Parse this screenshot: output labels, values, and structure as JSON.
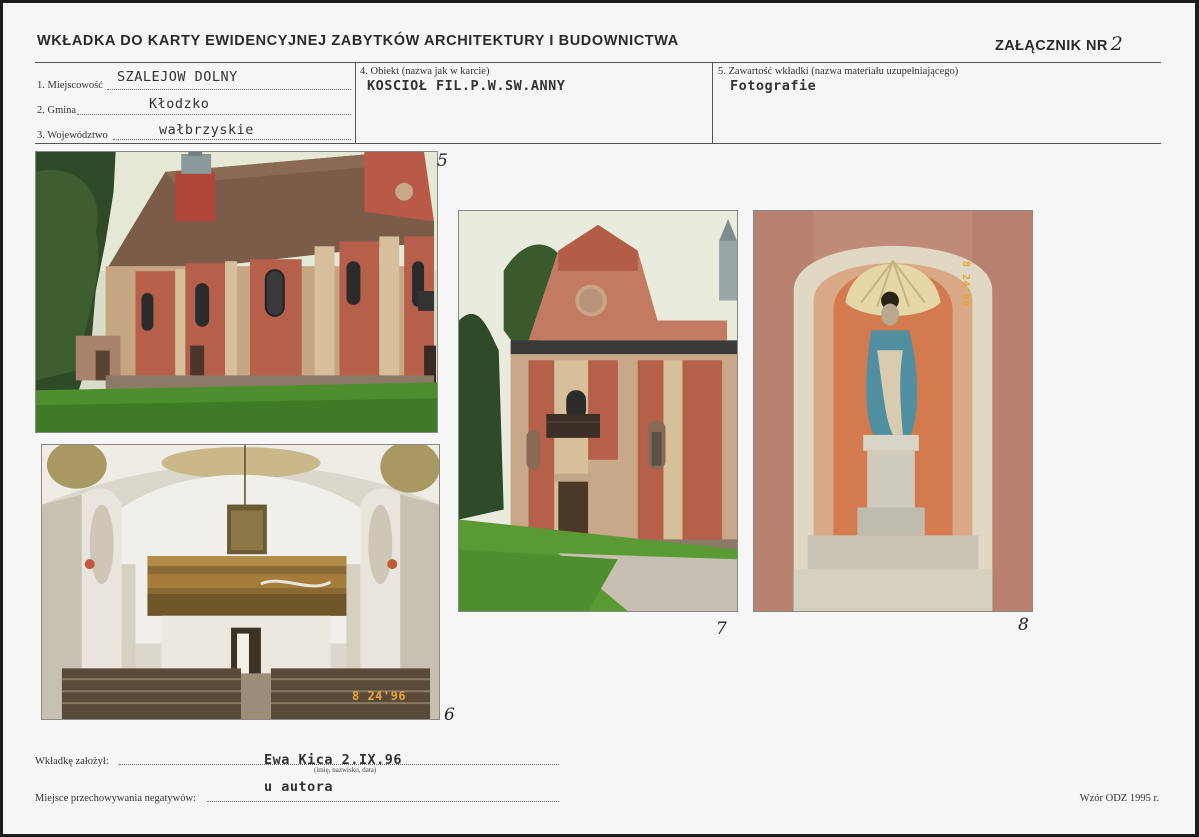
{
  "header": {
    "title": "WKŁADKA DO KARTY EWIDENCYJNEJ ZABYTKÓW ARCHITEKTURY I BUDOWNICTWA",
    "attachment_label": "ZAŁĄCZNIK NR",
    "attachment_number": "2"
  },
  "fields": {
    "miejscowosc": {
      "label": "1. Miejscowość",
      "value": "SZALEJOW DOLNY"
    },
    "gmina": {
      "label": "2. Gmina",
      "value": "Kłodzko"
    },
    "wojewodztwo": {
      "label": "3. Województwo",
      "value": "wałbrzyskie"
    },
    "obiekt": {
      "label": "4. Obiekt  (nazwa jak w karcie)",
      "value": "KOSCIOŁ FIL.P.W.SW.ANNY"
    },
    "zawartosc": {
      "label": "5. Zawartość wkładki  (nazwa materiału uzupełniającego)",
      "value": "Fotografie"
    }
  },
  "photos": [
    {
      "number": "5",
      "subject": "church-exterior-side"
    },
    {
      "number": "6",
      "subject": "church-interior",
      "date_stamp": "8 24'96"
    },
    {
      "number": "7",
      "subject": "church-facade"
    },
    {
      "number": "8",
      "subject": "statue-niche",
      "date_stamp": "8 24'96"
    }
  ],
  "footer": {
    "founder_label": "Wkładkę założył:",
    "founder_value": "Ewa Kica  2.IX.96",
    "founder_hint": "(imię, nazwisko, data)",
    "storage_label": "Miejsce przechowywania negatywów:",
    "storage_value": "u autora",
    "template_note": "Wzór ODZ 1995 r."
  }
}
